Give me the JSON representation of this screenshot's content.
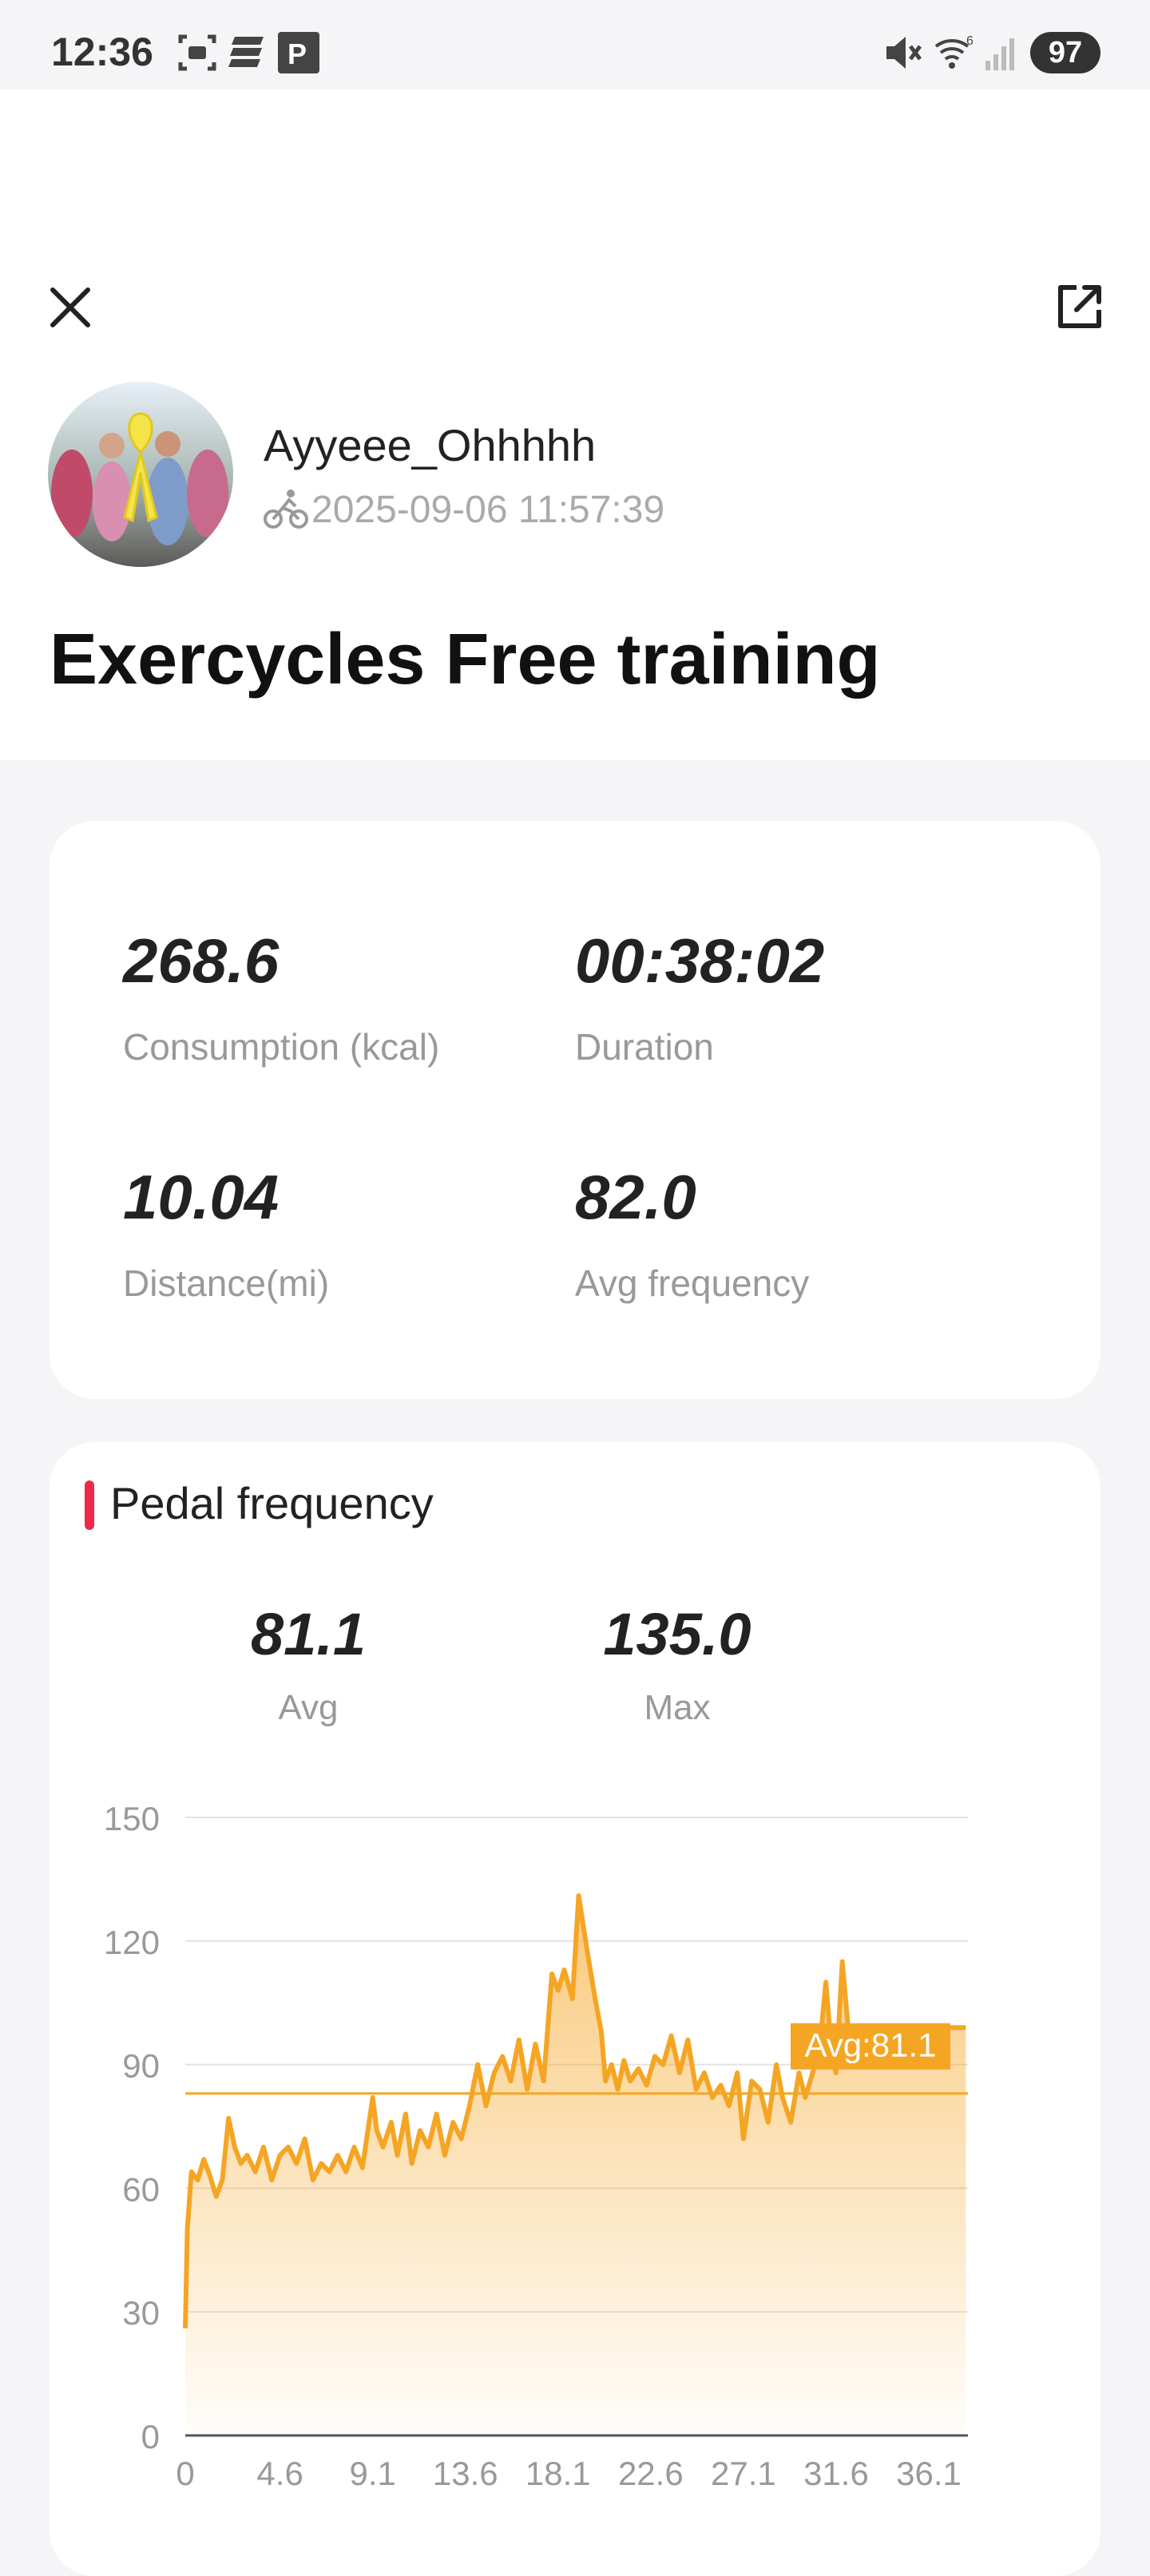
{
  "status_bar": {
    "time": "12:36",
    "battery": "97"
  },
  "header": {
    "username": "Ayyeee_Ohhhhh",
    "datetime": "2025-09-06 11:57:39",
    "title": "Exercycles Free training"
  },
  "stats": [
    {
      "value": "268.6",
      "label": "Consumption (kcal)"
    },
    {
      "value": "00:38:02",
      "label": "Duration"
    },
    {
      "value": "10.04",
      "label": "Distance(mi)"
    },
    {
      "value": "82.0",
      "label": "Avg frequency"
    }
  ],
  "pedal": {
    "title": "Pedal frequency",
    "avg_value": "81.1",
    "avg_label": "Avg",
    "max_value": "135.0",
    "max_label": "Max"
  },
  "colors": {
    "accent": "#f5a524",
    "section_bar": "#f0294c"
  },
  "chart_data": {
    "type": "area",
    "title": "",
    "xlabel": "",
    "ylabel": "",
    "ylim": [
      0,
      150
    ],
    "xlim": [
      0,
      38
    ],
    "y_ticks": [
      "0",
      "30",
      "60",
      "90",
      "120",
      "150"
    ],
    "x_ticks": [
      "0",
      "4.6",
      "9.1",
      "13.6",
      "18.1",
      "22.6",
      "27.1",
      "31.6",
      "36.1"
    ],
    "avg_line": {
      "value": 83,
      "label": "Avg:81.1"
    },
    "grid": true,
    "series": [
      {
        "x": [
          0,
          0.1,
          0.3,
          0.6,
          0.9,
          1.2,
          1.5,
          1.8,
          2.1,
          2.4,
          2.7,
          3.0,
          3.4,
          3.8,
          4.2,
          4.6,
          5.0,
          5.4,
          5.8,
          6.2,
          6.6,
          7.0,
          7.4,
          7.8,
          8.2,
          8.6,
          9.1,
          9.3,
          9.6,
          10.0,
          10.3,
          10.7,
          11.0,
          11.4,
          11.8,
          12.2,
          12.6,
          13.0,
          13.4,
          13.8,
          14.2,
          14.6,
          15.0,
          15.4,
          15.8,
          16.2,
          16.6,
          17.0,
          17.4,
          17.8,
          18.1,
          18.4,
          18.8,
          19.1,
          19.5,
          19.9,
          20.2,
          20.4,
          20.7,
          21.0,
          21.3,
          21.6,
          22.0,
          22.4,
          22.8,
          23.2,
          23.6,
          24.0,
          24.4,
          24.8,
          25.2,
          25.6,
          26.0,
          26.4,
          26.8,
          27.1,
          27.5,
          27.9,
          28.3,
          28.7,
          29.0,
          29.4,
          29.8,
          30.1,
          30.4,
          30.8,
          31.1,
          31.4,
          31.6,
          31.9,
          32.2,
          32.5,
          32.8,
          33.1,
          33.4,
          33.6,
          34.0,
          34.5,
          35.0,
          35.5,
          36.0,
          36.5,
          37.2,
          37.9
        ],
        "values": [
          26,
          50,
          64,
          62,
          67,
          63,
          58,
          62,
          77,
          70,
          66,
          68,
          64,
          70,
          62,
          68,
          70,
          66,
          72,
          62,
          66,
          64,
          68,
          64,
          70,
          65,
          82,
          74,
          70,
          76,
          68,
          78,
          66,
          74,
          70,
          78,
          68,
          76,
          72,
          80,
          90,
          80,
          88,
          92,
          86,
          96,
          84,
          95,
          86,
          112,
          108,
          113,
          106,
          131,
          118,
          106,
          98,
          86,
          90,
          84,
          91,
          86,
          89,
          85,
          92,
          90,
          97,
          88,
          96,
          84,
          88,
          82,
          85,
          80,
          88,
          72,
          86,
          84,
          76,
          90,
          82,
          76,
          88,
          82,
          87,
          94,
          110,
          92,
          88,
          115,
          98,
          98,
          98,
          99,
          99,
          99,
          99,
          99,
          99,
          99,
          99,
          99,
          99,
          99
        ]
      }
    ]
  }
}
